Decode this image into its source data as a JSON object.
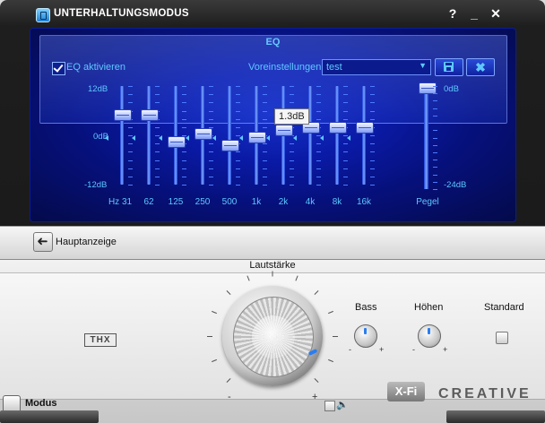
{
  "window": {
    "title": "UNTERHALTUNGSMODUS",
    "help": "?",
    "minimize": "_",
    "close": "✕"
  },
  "eq": {
    "title": "EQ",
    "enable_label": "EQ aktivieren",
    "enable_checked": true,
    "preset_label": "Voreinstellungen",
    "preset_value": "test",
    "db_top": "12dB",
    "db_mid": "0dB",
    "db_bottom": "-12dB",
    "tooltip": "1.3dB",
    "bands": [
      {
        "label": "Hz 31",
        "level_db": 5.0
      },
      {
        "label": "62",
        "level_db": 5.0
      },
      {
        "label": "125",
        "level_db": -1.5
      },
      {
        "label": "250",
        "level_db": 0.5
      },
      {
        "label": "500",
        "level_db": -2.5
      },
      {
        "label": "1k",
        "level_db": -0.5
      },
      {
        "label": "2k",
        "level_db": 1.3
      },
      {
        "label": "4k",
        "level_db": 2.0
      },
      {
        "label": "8k",
        "level_db": 2.0
      },
      {
        "label": "16k",
        "level_db": 2.0
      }
    ],
    "meter": {
      "label": "Pegel",
      "top": "0dB",
      "bottom": "-24dB"
    }
  },
  "nav": {
    "hauptanzeige": "Hauptanzeige"
  },
  "controls": {
    "volume_label": "Lautstärke",
    "bass_label": "Bass",
    "treble_label": "Höhen",
    "standard_label": "Standard",
    "minus": "-",
    "plus": "+",
    "thx": "THX",
    "xfi": "X-Fi",
    "brand": "CREATIVE",
    "mode_label": "Modus"
  },
  "colors": {
    "eq_accent": "#5ec8ff",
    "slider_blue": "#2a7df0"
  }
}
